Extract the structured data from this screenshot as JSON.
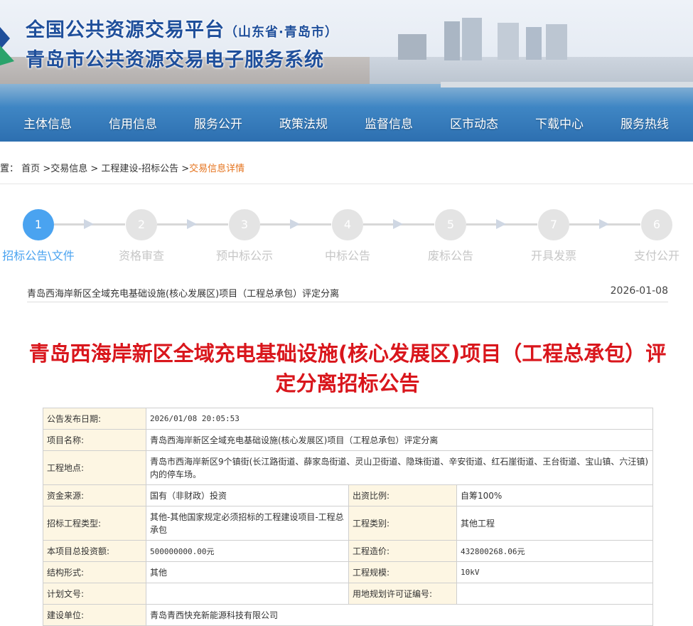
{
  "header": {
    "title_main": "全国公共资源交易平台",
    "title_sub": "（山东省·青岛市）",
    "title_system": "青岛市公共资源交易电子服务系统"
  },
  "nav": [
    "主体信息",
    "信用信息",
    "服务公开",
    "政策法规",
    "监督信息",
    "区市动态",
    "下载中心",
    "服务热线"
  ],
  "breadcrumb": {
    "prefix": "置：",
    "items": [
      "首页",
      ">交易信息",
      ">",
      "工程建设-招标公告",
      ">"
    ],
    "current": "交易信息详情"
  },
  "steps": [
    {
      "num": "1",
      "label": "招标公告\\文件",
      "active": true
    },
    {
      "num": "2",
      "label": "资格审查",
      "active": false
    },
    {
      "num": "3",
      "label": "预中标公示",
      "active": false
    },
    {
      "num": "4",
      "label": "中标公告",
      "active": false
    },
    {
      "num": "5",
      "label": "废标公告",
      "active": false
    },
    {
      "num": "7",
      "label": "开具发票",
      "active": false
    },
    {
      "num": "6",
      "label": "支付公开",
      "active": false
    }
  ],
  "notice": {
    "title": "青岛西海岸新区全域充电基础设施(核心发展区)项目（工程总承包）评定分离",
    "date": "2026-01-08"
  },
  "article_title": "青岛西海岸新区全域充电基础设施(核心发展区)项目（工程总承包）评定分离招标公告",
  "table": {
    "publish_date_label": "公告发布日期:",
    "publish_date": "2026/01/08 20:05:53",
    "project_name_label": "项目名称:",
    "project_name": "青岛西海岸新区全域充电基础设施(核心发展区)项目（工程总承包）评定分离",
    "location_label": "工程地点:",
    "location": "青岛市西海岸新区9个镇街(长江路街道、薛家岛街道、灵山卫街道、隐珠街道、辛安街道、红石崖街道、王台街道、宝山镇、六汪镇)内的停车场。",
    "fund_source_label": "资金来源:",
    "fund_source": "国有（非财政）投资",
    "invest_ratio_label": "出资比例:",
    "invest_ratio": "自筹100%",
    "bid_type_label": "招标工程类型:",
    "bid_type": "其他-其他国家规定必须招标的工程建设项目-工程总承包",
    "category_label": "工程类别:",
    "category": "其他工程",
    "total_invest_label": "本项目总投资额:",
    "total_invest": "500000000.00元",
    "cost_label": "工程造价:",
    "cost": "432800268.06元",
    "structure_label": "结构形式:",
    "structure": "其他",
    "scale_label": "工程规模:",
    "scale": "10kV",
    "plan_doc_label": "计划文号:",
    "plan_doc": "",
    "land_permit_label": "用地规划许可证编号:",
    "land_permit": "",
    "builder_label": "建设单位:",
    "builder": "青岛青西快充新能源科技有限公司"
  }
}
